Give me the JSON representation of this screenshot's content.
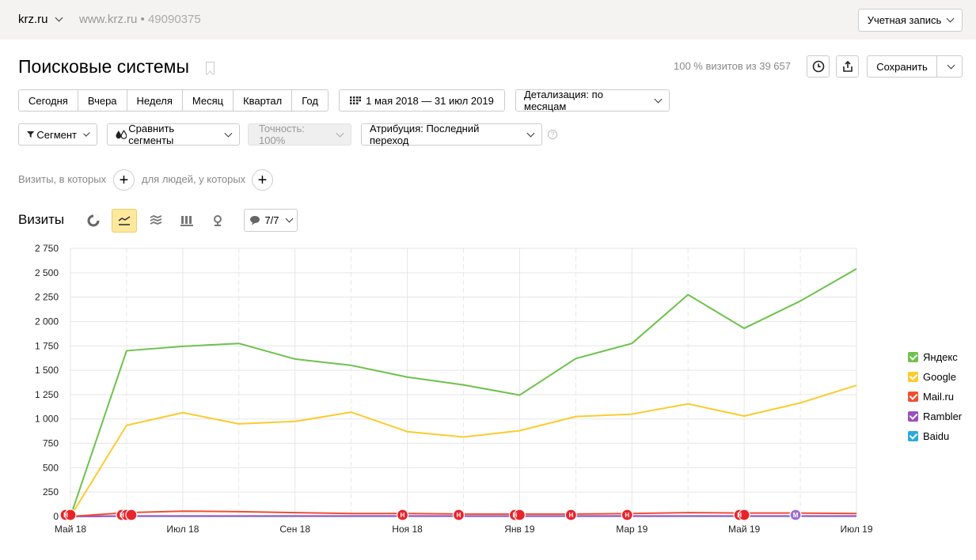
{
  "header": {
    "site_name": "krz.ru",
    "site_url": "www.krz.ru",
    "separator": "•",
    "counter_id": "49090375",
    "account_label": "Учетная запись"
  },
  "page": {
    "title": "Поисковые системы",
    "visits_share": "100 % визитов из 39 657",
    "save_label": "Сохранить"
  },
  "periods": [
    "Сегодня",
    "Вчера",
    "Неделя",
    "Месяц",
    "Квартал",
    "Год"
  ],
  "date_range": "1 мая 2018 — 31 июл 2019",
  "detail_label": "Детализация: по месяцам",
  "segment_label": "Сегмент",
  "compare_label": "Сравнить сегменты",
  "accuracy_label": "Точность: 100%",
  "attribution_label": "Атрибуция: Последний переход",
  "help_label": "?",
  "filters": {
    "visits_label": "Визиты, в которых",
    "people_label": "для людей, у которых",
    "plus": "+"
  },
  "section": {
    "title": "Визиты",
    "notes_count": "7/7"
  },
  "colors": {
    "yandex": "#6dc24b",
    "google": "#fbcb2f",
    "mailru": "#f04f30",
    "rambler": "#9a4fc1",
    "baidu": "#2aa9de",
    "active_tab": "#fee89c"
  },
  "chart_data": {
    "type": "line",
    "x": [
      "2018-05",
      "2018-06",
      "2018-07",
      "2018-08",
      "2018-09",
      "2018-10",
      "2018-11",
      "2018-12",
      "2019-01",
      "2019-02",
      "2019-03",
      "2019-04",
      "2019-05",
      "2019-06",
      "2019-07"
    ],
    "x_tick_labels": [
      "Май 18",
      "Июл 18",
      "Сен 18",
      "Ноя 18",
      "Янв 19",
      "Мар 19",
      "Май 19",
      "Июл 19"
    ],
    "y_tick_labels": [
      "0",
      "250",
      "500",
      "750",
      "1 000",
      "1 250",
      "1 500",
      "1 750",
      "2 000",
      "2 250",
      "2 500",
      "2 750"
    ],
    "ylim": [
      0,
      2750
    ],
    "grid": true,
    "legend_position": "right",
    "series": [
      {
        "name": "Яндекс",
        "color": "#6dc24b",
        "values": [
          0,
          1700,
          1745,
          1775,
          1615,
          1550,
          1430,
          1350,
          1245,
          1620,
          1775,
          2275,
          1930,
          2210,
          2540
        ]
      },
      {
        "name": "Google",
        "color": "#fbcb2f",
        "values": [
          0,
          935,
          1065,
          950,
          975,
          1070,
          870,
          815,
          880,
          1025,
          1050,
          1155,
          1030,
          1165,
          1345
        ]
      },
      {
        "name": "Mail.ru",
        "color": "#f04f30",
        "values": [
          0,
          40,
          55,
          50,
          40,
          30,
          30,
          25,
          25,
          25,
          30,
          40,
          35,
          35,
          30
        ]
      },
      {
        "name": "Rambler",
        "color": "#9a4fc1",
        "values": [
          0,
          5,
          5,
          5,
          5,
          5,
          5,
          5,
          5,
          5,
          5,
          5,
          5,
          5,
          5
        ]
      },
      {
        "name": "Baidu",
        "color": "#2aa9de",
        "values": [
          0,
          3,
          3,
          3,
          3,
          3,
          3,
          3,
          3,
          3,
          3,
          3,
          3,
          3,
          3
        ]
      }
    ],
    "annotations": [
      {
        "x": "2018-05",
        "labels": [
          "Н",
          "Н"
        ]
      },
      {
        "x": "2018-06",
        "labels": [
          "Н",
          "Н",
          "Н"
        ]
      },
      {
        "x": "2018-11",
        "labels": [
          "Н"
        ]
      },
      {
        "x": "2018-12",
        "labels": [
          "Н"
        ]
      },
      {
        "x": "2019-01",
        "labels": [
          "Н",
          "Н"
        ]
      },
      {
        "x": "2019-02",
        "labels": [
          "Н"
        ]
      },
      {
        "x": "2019-03",
        "labels": [
          "Н"
        ]
      },
      {
        "x": "2019-05",
        "labels": [
          "Н",
          "Н"
        ]
      },
      {
        "x": "2019-06",
        "labels": [
          "М"
        ]
      }
    ]
  }
}
